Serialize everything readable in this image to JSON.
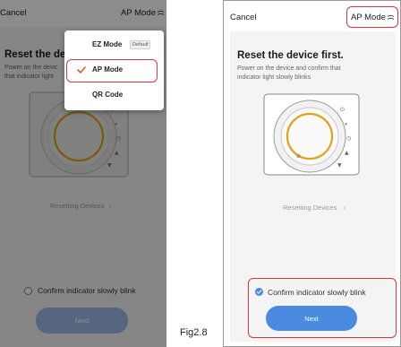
{
  "left": {
    "cancel": "Cancel",
    "mode_label": "AP Mode",
    "heading": "Reset the de",
    "desc": "Power on the devic that indicator light",
    "resetting": "Resetting Devices",
    "confirm": "Confirm indicator slowly blink",
    "next": "Next",
    "menu": {
      "items": [
        {
          "label": "EZ Mode",
          "badge": "Default"
        },
        {
          "label": "AP Mode",
          "selected": true
        },
        {
          "label": "QR Code"
        }
      ]
    }
  },
  "right": {
    "cancel": "Cancel",
    "mode_label": "AP Mode",
    "heading": "Reset the device first.",
    "desc": "Power on the device and confirm that indicator light slowly blinks",
    "resetting": "Resetting Devices",
    "confirm": "Confirm indicator slowly blink",
    "next": "Next"
  },
  "figure_label": "Fig2.8",
  "colors": {
    "accent_blue": "#4a8ae0",
    "highlight_red": "#d9363e",
    "ring_yellow": "#e0a21a",
    "check_red": "#e8553e"
  },
  "icons": [
    "wifi-swap-icon",
    "chevron-right-icon",
    "check-icon",
    "radio-icon",
    "thermostat-illustration"
  ]
}
